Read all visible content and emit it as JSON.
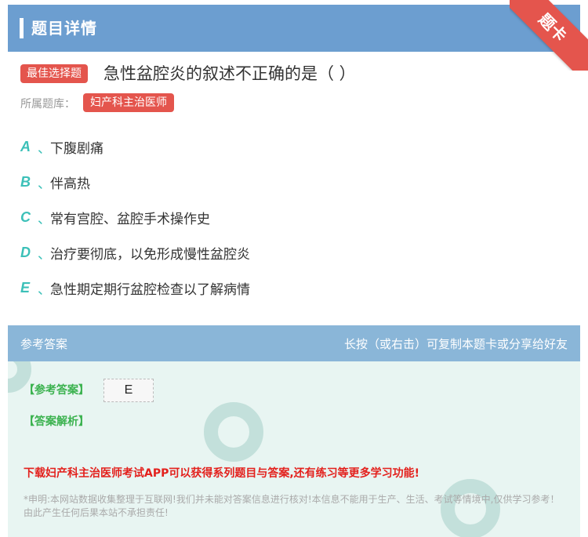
{
  "header": {
    "title": "题目详情",
    "ribbon": "题卡"
  },
  "question": {
    "tag": "最佳选择题",
    "text": "急性盆腔炎的叙述不正确的是（ ）",
    "bank_label": "所属题库：",
    "bank_name": "妇产科主治医师"
  },
  "options": [
    {
      "letter": "A",
      "sep": "、",
      "text": "下腹剧痛"
    },
    {
      "letter": "B",
      "sep": "、",
      "text": "伴高热"
    },
    {
      "letter": "C",
      "sep": "、",
      "text": "常有宫腔、盆腔手术操作史"
    },
    {
      "letter": "D",
      "sep": "、",
      "text": "治疗要彻底，以免形成慢性盆腔炎"
    },
    {
      "letter": "E",
      "sep": "、",
      "text": "急性期定期行盆腔检查以了解病情"
    }
  ],
  "answer": {
    "header_left": "参考答案",
    "header_right": "长按（或右击）可复制本题卡或分享给好友",
    "answer_label": "【参考答案】",
    "answer_value": "E",
    "explain_label": "【答案解析】",
    "promo": "下载妇产科主治医师考试APP可以获得系列题目与答案,还有练习等更多学习功能!",
    "disclaimer": "*申明:本网站数据收集整理于互联网!我们并未能对答案信息进行核对!本信息不能用于生产、生活、考试等情境中,仅供学习参考！由此产生任何后果本站不承担责任!"
  },
  "colors": {
    "header": "#6c9ed0",
    "accent_red": "#e4554d",
    "option_letter": "#3cc0b8",
    "answer_header": "#8ab6d8",
    "answer_green": "#3bb24f",
    "promo_red": "#e3201c"
  }
}
